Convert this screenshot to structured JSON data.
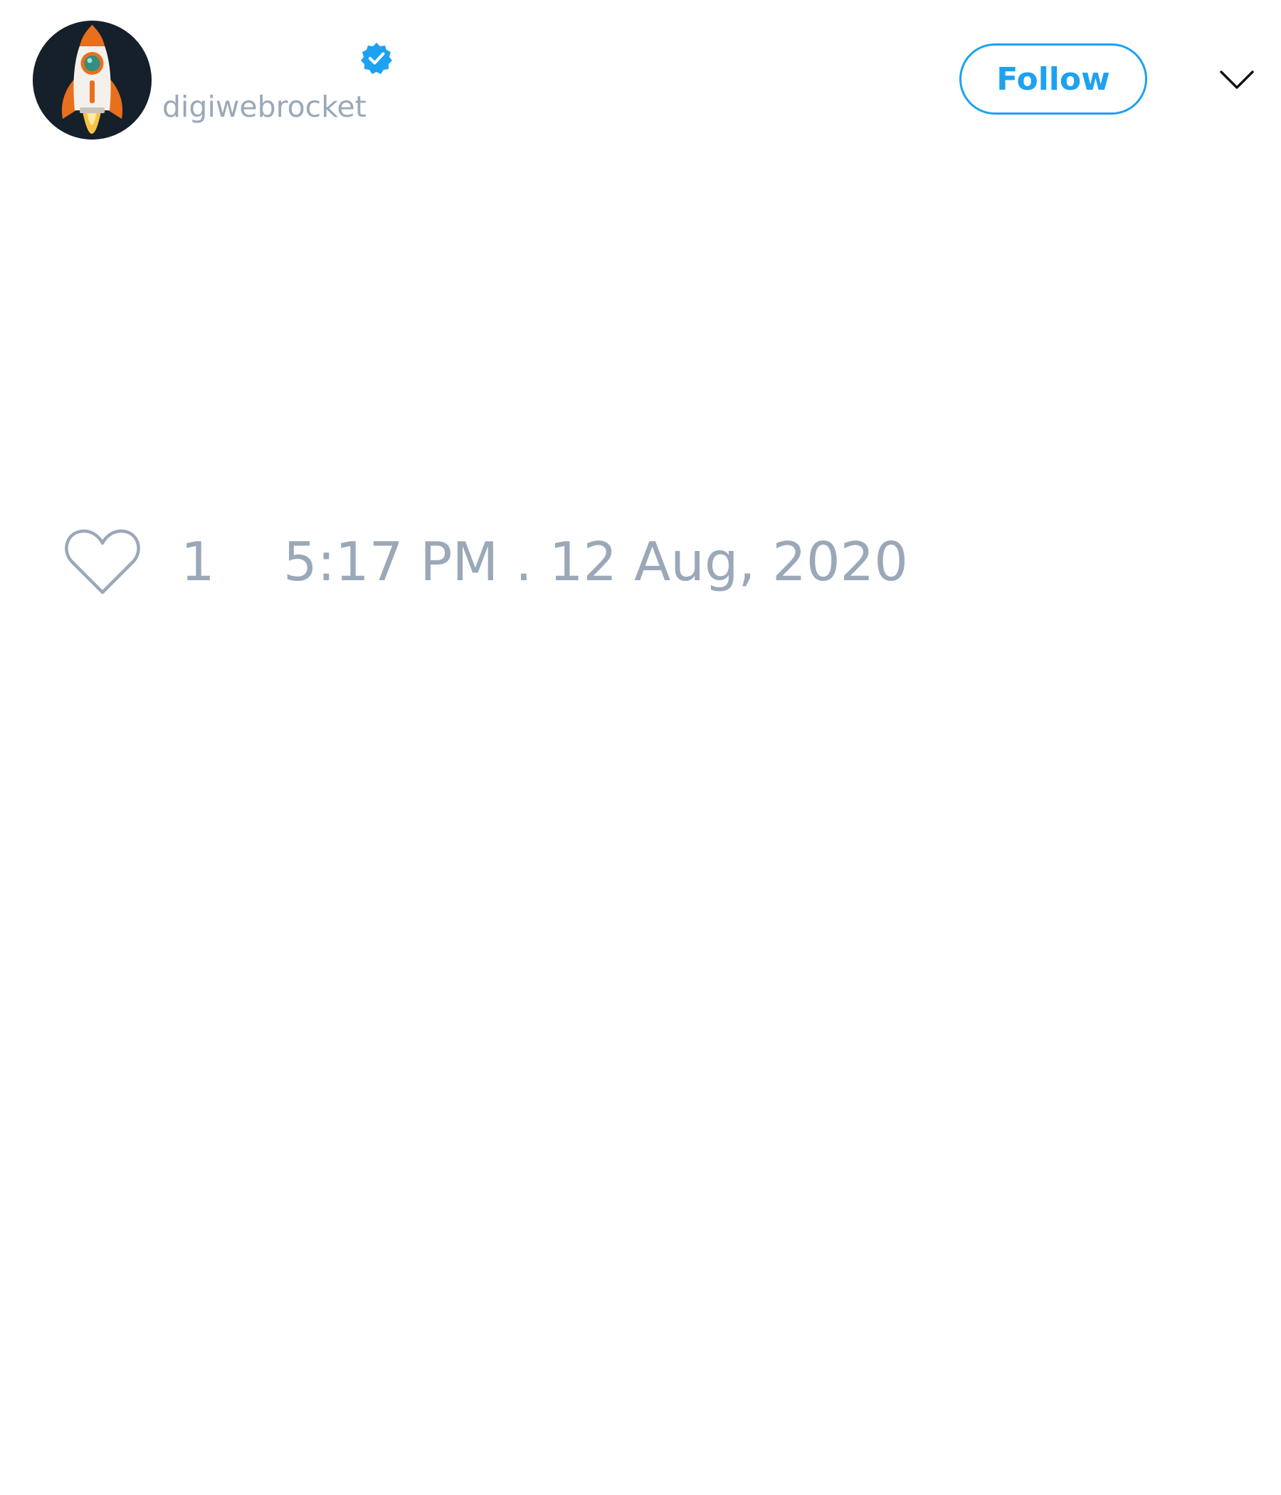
{
  "author": {
    "handle": "digiwebrocket",
    "verified": true,
    "avatar_icon": "rocket-icon"
  },
  "header": {
    "follow_label": "Follow",
    "menu_icon": "chevron-down-icon"
  },
  "tweet": {
    "like_icon": "heart-icon",
    "like_count": "1",
    "timestamp": "5:17 PM . 12 Aug, 2020"
  },
  "colors": {
    "accent": "#1da1f2",
    "muted_text": "#9aa8b8",
    "avatar_bg": "#15202b",
    "background": "#ffffff"
  }
}
